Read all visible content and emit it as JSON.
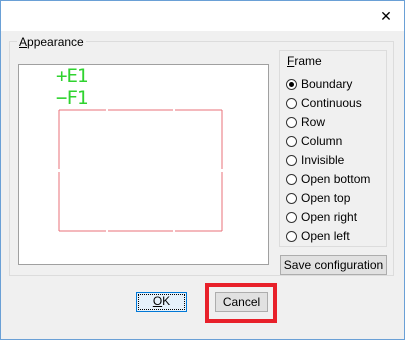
{
  "title_bar": {
    "close_glyph": "✕"
  },
  "appearance": {
    "legend_first": "A",
    "legend_rest": "ppearance",
    "preview": {
      "label_plus": "+E1",
      "label_minus": "−F1",
      "label_color": "#2fd32f",
      "frame_color": "#e8707a"
    }
  },
  "frame": {
    "legend_first": "F",
    "legend_rest": "rame",
    "selected": "Boundary",
    "options": [
      "Boundary",
      "Continuous",
      "Row",
      "Column",
      "Invisible",
      "Open bottom",
      "Open top",
      "Open right",
      "Open left"
    ]
  },
  "buttons": {
    "save": "Save configuration",
    "ok_first": "O",
    "ok_rest": "K",
    "cancel": "Cancel"
  },
  "highlight_color": "#e8202a"
}
